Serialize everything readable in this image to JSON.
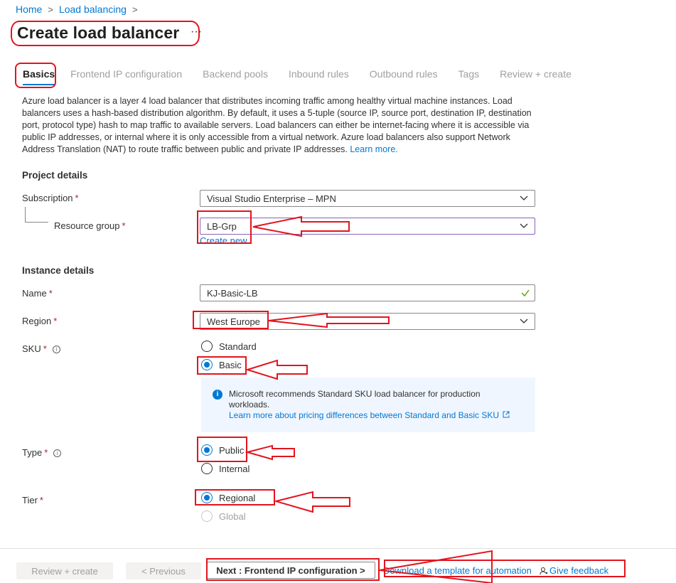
{
  "breadcrumb": {
    "home": "Home",
    "parent": "Load balancing",
    "sep": ">"
  },
  "page": {
    "title": "Create load balancer",
    "more": "···"
  },
  "tabs": [
    {
      "label": "Basics"
    },
    {
      "label": "Frontend IP configuration"
    },
    {
      "label": "Backend pools"
    },
    {
      "label": "Inbound rules"
    },
    {
      "label": "Outbound rules"
    },
    {
      "label": "Tags"
    },
    {
      "label": "Review + create"
    }
  ],
  "description": {
    "text": "Azure load balancer is a layer 4 load balancer that distributes incoming traffic among healthy virtual machine instances. Load balancers uses a hash-based distribution algorithm. By default, it uses a 5-tuple (source IP, source port, destination IP, destination port, protocol type) hash to map traffic to available servers. Load balancers can either be internet-facing where it is accessible via public IP addresses, or internal where it is only accessible from a virtual network. Azure load balancers also support Network Address Translation (NAT) to route traffic between public and private IP addresses.",
    "learn_more": "Learn more."
  },
  "project": {
    "heading": "Project details",
    "subscription_label": "Subscription",
    "subscription_value": "Visual Studio Enterprise – MPN",
    "rg_label": "Resource group",
    "rg_value": "LB-Grp",
    "create_new": "Create new",
    "required_mark": "*"
  },
  "instance": {
    "heading": "Instance details",
    "name_label": "Name",
    "name_value": "KJ-Basic-LB",
    "region_label": "Region",
    "region_value": "West Europe",
    "sku_label": "SKU",
    "sku_options": {
      "standard": "Standard",
      "basic": "Basic"
    },
    "sku_selected": "Basic",
    "info_text": "Microsoft recommends Standard SKU load balancer for production workloads.",
    "info_link": "Learn more about pricing differences between Standard and Basic SKU",
    "type_label": "Type",
    "type_options": {
      "public": "Public",
      "internal": "Internal"
    },
    "type_selected": "Public",
    "tier_label": "Tier",
    "tier_options": {
      "regional": "Regional",
      "global": "Global"
    },
    "tier_selected": "Regional"
  },
  "footer": {
    "review_create": "Review + create",
    "previous": "< Previous",
    "next": "Next : Frontend IP configuration >",
    "download_template": "Download a template for automation",
    "feedback": "Give feedback"
  },
  "colors": {
    "accent": "#0078d4",
    "annotation": "#e3141e",
    "required": "#a4262c",
    "valid_check": "#57a300"
  }
}
